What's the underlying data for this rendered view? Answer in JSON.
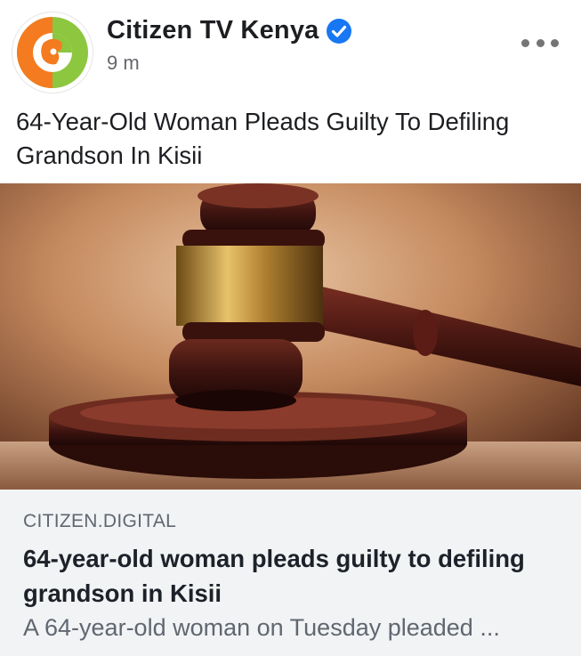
{
  "post": {
    "page_name": "Citizen TV Kenya",
    "timestamp": "9 m",
    "text": "64-Year-Old Woman Pleads Guilty To Defiling Grandson In Kisii",
    "avatar_icon": "citizen-tv-logo",
    "verified_icon": "verified-badge-icon",
    "more_icon": "more-options-icon",
    "image_icon": "gavel-image"
  },
  "link_preview": {
    "domain": "CITIZEN.DIGITAL",
    "title": "64-year-old woman pleads guilty to defiling grandson in Kisii",
    "description": "A 64-year-old woman on Tuesday pleaded ..."
  },
  "colors": {
    "verified_blue": "#1877f2",
    "logo_orange": "#f47b20",
    "logo_green": "#8dc63f",
    "preview_background": "#f2f3f5"
  }
}
